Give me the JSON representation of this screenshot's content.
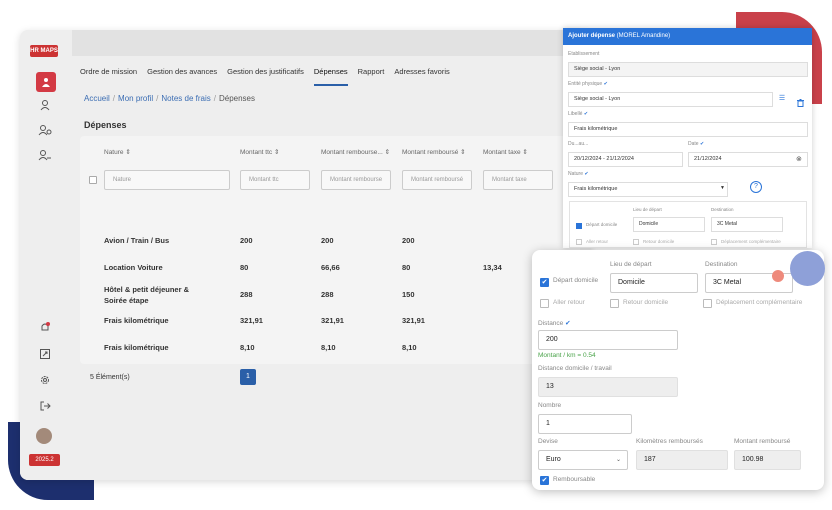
{
  "sidebar": {
    "logo": "HR MAPS",
    "year_badge": "2025.2"
  },
  "tabs": [
    "Ordre de mission",
    "Gestion des avances",
    "Gestion des justificatifs",
    "Dépenses",
    "Rapport",
    "Adresses favoris"
  ],
  "breadcrumb": {
    "b1": "Accueil",
    "b2": "Mon profil",
    "b3": "Notes de frais",
    "current": "Dépenses",
    "sep": "/"
  },
  "page_title": "Dépenses",
  "table": {
    "headers": [
      "Nature ⇕",
      "Montant ttc ⇕",
      "Montant rembourse... ⇕",
      "Montant remboursé ⇕",
      "Montant taxe ⇕"
    ],
    "filters": [
      "Nature",
      "Montant ttc",
      "Montant rembourse",
      "Montant remboursé",
      "Montant taxe"
    ],
    "rows": [
      {
        "nature": "Avion / Train / Bus",
        "ttc": "200",
        "remb1": "200",
        "remb2": "200",
        "taxe": ""
      },
      {
        "nature": "Location Voiture",
        "ttc": "80",
        "remb1": "66,66",
        "remb2": "80",
        "taxe": "13,34"
      },
      {
        "nature": "Hôtel & petit déjeuner & Soirée étape",
        "ttc": "288",
        "remb1": "288",
        "remb2": "150",
        "taxe": ""
      },
      {
        "nature": "Frais kilométrique",
        "ttc": "321,91",
        "remb1": "321,91",
        "remb2": "321,91",
        "taxe": ""
      },
      {
        "nature": "Frais kilométrique",
        "ttc": "8,10",
        "remb1": "8,10",
        "remb2": "8,10",
        "taxe": ""
      }
    ],
    "count_label": "5 Élément(s)",
    "page": "1"
  },
  "modal": {
    "title": "Ajouter dépense",
    "subtitle": "(MOREL Amandine)",
    "etab_label": "Etablissement",
    "etab_value": "Siège social - Lyon",
    "entite_label": "Entité physique",
    "entite_value": "Siège social - Lyon",
    "libelle_label": "Libellé",
    "libelle_value": "Frais kilométrique",
    "du_label": "Du...au...",
    "du_value": "20/12/2024 - 21/12/2024",
    "date_label": "Date",
    "date_value": "21/12/2024",
    "nature_label": "Nature",
    "nature_value": "Frais kilométrique",
    "lieu_depart": "Lieu de départ",
    "destination": "Destination",
    "depart_domicile": "Départ domicile",
    "domicile": "Domicile",
    "dest_value": "3C Metal",
    "aller_retour": "Aller retour",
    "retour_domicile": "Retour domicile",
    "deplacement": "Déplacement complémentaire",
    "check": "✔"
  },
  "popup": {
    "depart_domicile": "Départ domicile",
    "lieu_depart": "Lieu de départ",
    "destination": "Destination",
    "domicile": "Domicile",
    "dest_value": "3C Metal",
    "aller_retour": "Aller retour",
    "retour_domicile": "Retour domicile",
    "deplacement": "Déplacement complémentaire",
    "distance_label": "Distance",
    "distance_value": "200",
    "rate": "Montant / km = 0.54",
    "dom_trav_label": "Distance domicile / travail",
    "dom_trav_value": "13",
    "nombre_label": "Nombre",
    "nombre_value": "1",
    "devise_label": "Devise",
    "devise_value": "Euro",
    "km_label": "Kilomètres remboursés",
    "km_value": "187",
    "montant_label": "Montant remboursé",
    "montant_value": "100.98",
    "remboursable": "Remboursable",
    "check": "✔"
  }
}
